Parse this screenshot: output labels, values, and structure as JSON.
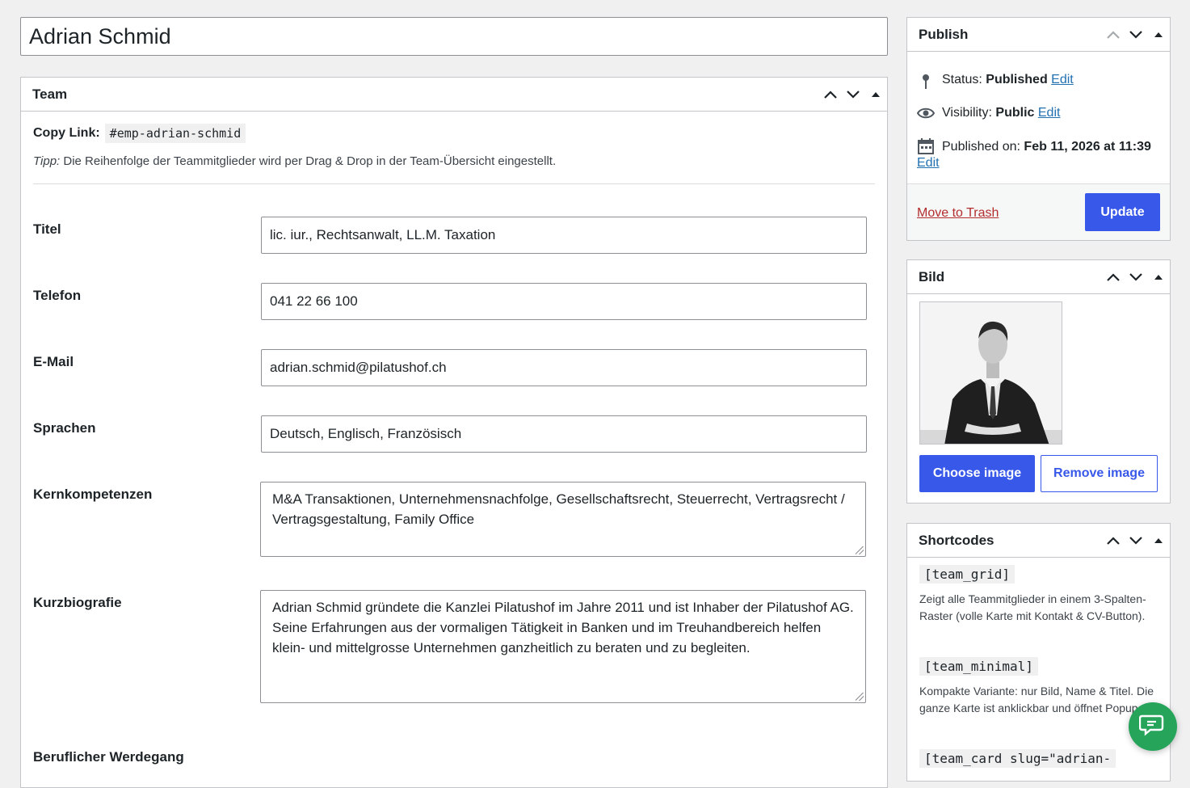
{
  "post": {
    "title": "Adrian Schmid"
  },
  "team_box": {
    "title": "Team",
    "copy_label": "Copy Link:",
    "copy_slug": "#emp-adrian-schmid",
    "tip_prefix": "Tipp:",
    "tip_text": " Die Reihenfolge der Teammitglieder wird per Drag & Drop in der Team-Übersicht eingestellt.",
    "fields": {
      "titel": {
        "label": "Titel",
        "value": "lic. iur., Rechtsanwalt, LL.M. Taxation"
      },
      "telefon": {
        "label": "Telefon",
        "value": "041 22 66 100"
      },
      "email": {
        "label": "E-Mail",
        "value": "adrian.schmid@pilatushof.ch"
      },
      "sprachen": {
        "label": "Sprachen",
        "value": "Deutsch, Englisch, Französisch"
      },
      "kernkompetenzen": {
        "label": "Kernkompetenzen",
        "value": "M&A Transaktionen, Unternehmensnachfolge, Gesellschaftsrecht, Steuerrecht, Vertragsrecht / Vertragsgestaltung, Family Office"
      },
      "kurzbiografie": {
        "label": "Kurzbiografie",
        "value": "Adrian Schmid gründete die Kanzlei Pilatushof im Jahre 2011 und ist Inhaber der Pilatushof AG. Seine Erfahrungen aus der vormaligen Tätigkeit in Banken und im Treuhandbereich helfen klein- und mittelgrosse Unternehmen ganzheitlich zu beraten und zu begleiten."
      },
      "werdegang": {
        "label": "Beruflicher Werdegang"
      }
    }
  },
  "publish": {
    "title": "Publish",
    "status_label": "Status:",
    "status_value": "Published",
    "visibility_label": "Visibility:",
    "visibility_value": "Public",
    "published_label": "Published on:",
    "published_value": "Feb 11, 2026 at 11:39",
    "edit_label": "Edit",
    "trash_label": "Move to Trash",
    "update_label": "Update"
  },
  "bild": {
    "title": "Bild",
    "choose_label": "Choose image",
    "remove_label": "Remove image"
  },
  "shortcodes": {
    "title": "Shortcodes",
    "items": [
      {
        "code": "[team_grid]",
        "desc": "Zeigt alle Teammitglieder in einem 3-Spalten-Raster (volle Karte mit Kontakt & CV-Button)."
      },
      {
        "code": "[team_minimal]",
        "desc": "Kompakte Variante: nur Bild, Name & Titel. Die ganze Karte ist anklickbar und öffnet Popup."
      },
      {
        "code": "[team_card slug=\"adrian-"
      }
    ]
  },
  "colors": {
    "primary": "#3858e9",
    "link": "#2271b1",
    "danger": "#b32d2e",
    "chat": "#25a45a"
  },
  "icons": [
    "pin-icon",
    "eye-icon",
    "calendar-icon",
    "chevron-up-icon",
    "chevron-down-icon",
    "toggle-arrow-icon",
    "chat-icon"
  ]
}
